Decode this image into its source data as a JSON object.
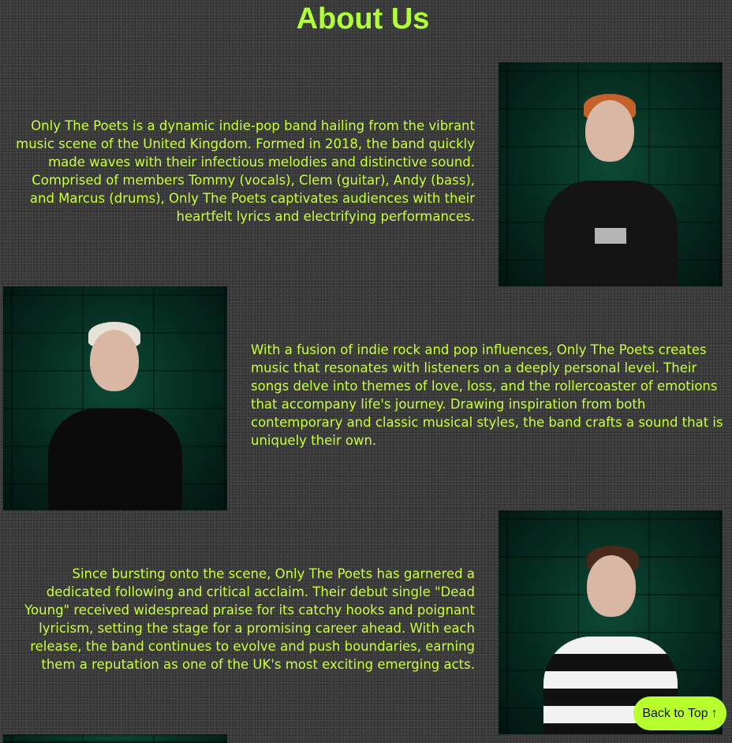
{
  "page": {
    "title": "About Us"
  },
  "sections": [
    {
      "text": "Only The  Poets is a dynamic indie-pop band hailing from the vibrant music scene of the United  Kingdom.  Formed in 2018, the band quickly made waves with their infectious melodies and distinctive sound.  Comprised of members Tommy (vocals), Clem (guitar), Andy (bass), and Marcus (drums), Only The  Poets captivates audiences with their heartfelt lyrics and electrifying performances.",
      "image_alt": "band member photo"
    },
    {
      "text": "With a fusion of indie rock and pop influences, Only The  Poets creates music that resonates with listeners on a deeply personal level. Their songs delve into themes of love, loss, and the rollercoaster of emotions that accompany life's journey.  Drawing inspiration from both contemporary and classic musical styles, the band crafts a sound that is uniquely their own.",
      "image_alt": "band member photo"
    },
    {
      "text": "Since bursting onto the scene, Only The  Poets has garnered a dedicated following and critical acclaim. Their debut single \"Dead Young\" received widespread praise for its catchy hooks and poignant lyricism, setting the stage for a promising career ahead. With each release, the band continues to evolve and push boundaries, earning them a reputation as one of the UK's most exciting emerging acts.",
      "image_alt": "band member photo"
    }
  ],
  "back_to_top": {
    "label": "Back to Top",
    "icon": "↑"
  },
  "colors": {
    "accent": "#b0ff3a",
    "text": "#c8ff3c",
    "background": "#3a3a3a",
    "button_bg": "#b8ff2e"
  }
}
